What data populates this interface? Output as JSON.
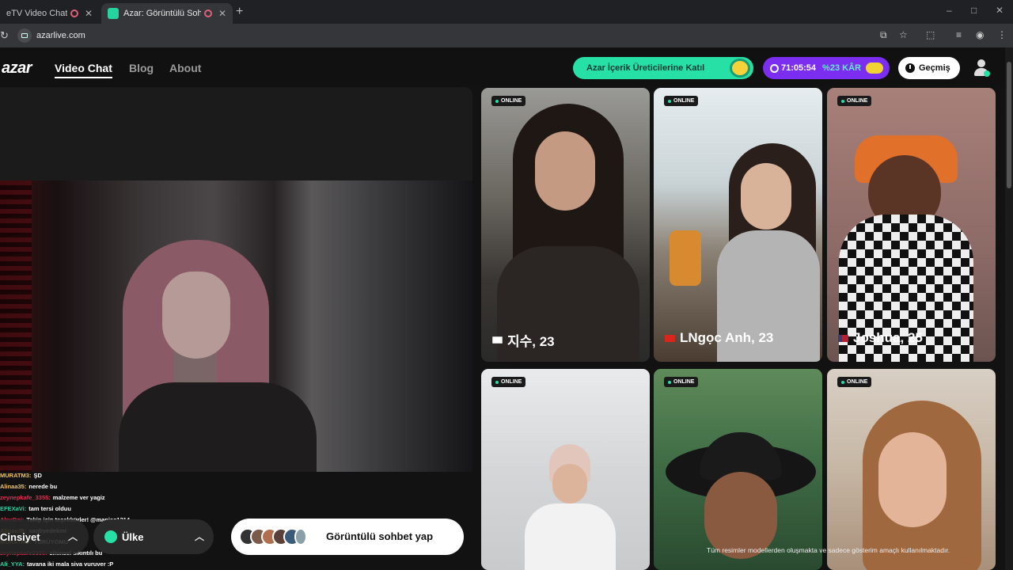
{
  "browser": {
    "tabs": [
      {
        "title": "eTV Video Chat — Ome",
        "active": false
      },
      {
        "title": "Azar: Görüntülü Sohbet & V",
        "active": true
      }
    ],
    "new_tab": "+",
    "url": "azarlive.com",
    "window_controls": [
      "–",
      "□",
      "✕"
    ]
  },
  "header": {
    "logo": "azar",
    "nav": [
      {
        "label": "Video Chat",
        "active": true
      },
      {
        "label": "Blog",
        "active": false
      },
      {
        "label": "About",
        "active": false
      }
    ],
    "creator_button": "Azar İçerik Üreticilerine Katıl",
    "timer": "71:05:54",
    "discount": "%23 KÂR",
    "history_button": "Geçmiş"
  },
  "chat": [
    {
      "user": "MURATM3:",
      "text": "ŞD",
      "color": "#f0c060"
    },
    {
      "user": "Alinaa35:",
      "text": "nerede bu",
      "color": "#f0c060"
    },
    {
      "user": "zeynepkafe_3355:",
      "text": "malzeme ver yagiz",
      "color": "#e03050"
    },
    {
      "user": "EFEXaVi:",
      "text": "tam tersi olduu",
      "color": "#30d0a0"
    },
    {
      "user": "AlexBoi:",
      "text": "Takip için teşekkürler! @maniac1314",
      "color": "#e03050"
    },
    {
      "user": "Alinaa35:",
      "text": "sanbyedekmi",
      "color": "#f0c060"
    },
    {
      "user": "MURATM3:",
      "text": "YÜRÜYOMU",
      "color": "#f0c060"
    },
    {
      "user": "zeynepkafe3355:",
      "text": "zihinsel sıkıntılı bu",
      "color": "#e03050"
    },
    {
      "user": "Ali_YYA:",
      "text": "tavana iki mala siva vuruver :P",
      "color": "#30d0a0"
    }
  ],
  "controls": {
    "gender": "Cinsiyet",
    "country": "Ülke",
    "start_button": "Görüntülü sohbet yap"
  },
  "cards": [
    {
      "status": "ONLINE",
      "name": "지수, 23",
      "flag_colors": [
        "#ffffff",
        "#c83040"
      ]
    },
    {
      "status": "ONLINE",
      "name": "LNgọc Anh, 23",
      "flag_colors": [
        "#da251d",
        "#ffdd00"
      ]
    },
    {
      "status": "ONLINE",
      "name": "Joshua, 25",
      "flag_colors": [
        "#b22234",
        "#3c3b6e"
      ]
    },
    {
      "status": "ONLINE",
      "name": "",
      "flag_colors": []
    },
    {
      "status": "ONLINE",
      "name": "",
      "flag_colors": []
    },
    {
      "status": "ONLINE",
      "name": "",
      "flag_colors": []
    }
  ],
  "disclaimer": "Tüm resimler modellerden oluşmakta ve sadece gösterim amaçlı kullanılmaktadır.",
  "colors": {
    "accent_green": "#27e0a5",
    "accent_purple": "#7b2df0",
    "background": "#121212"
  }
}
